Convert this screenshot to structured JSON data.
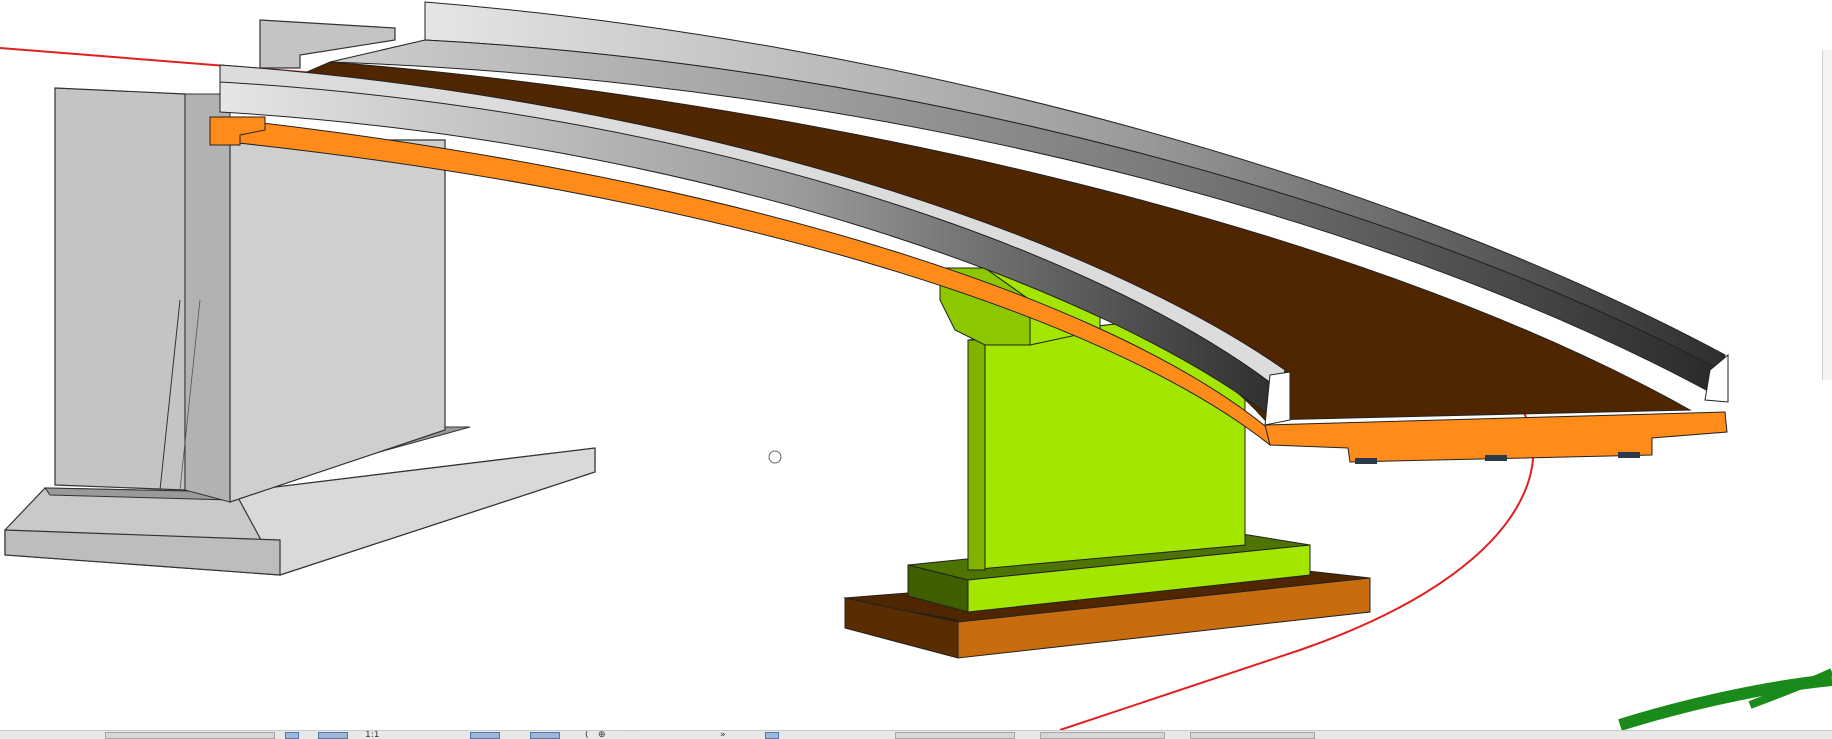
{
  "viewport": {
    "label": "",
    "elements": {
      "abutment_color": "#c9c9c9",
      "abutment_shadow": "#7a7a7a",
      "deck_color": "#4f2600",
      "parapet_light": "#d4d4d4",
      "parapet_dark": "#3a3a3a",
      "bearing_beam_color": "#ff8c1a",
      "pier_color": "#a3e600",
      "pier_shadow": "#4d7300",
      "pile_cap_color": "#c86c10",
      "alignment_color": "#e02020",
      "view_cube_color": "#1a8a1a"
    }
  },
  "statusbar": {
    "icons": [
      "view-scale-icon",
      "detail-level-icon",
      "visual-style-icon",
      "sun-path-icon",
      "shadows-icon",
      "crop-icon",
      "hide-icon",
      "constraints-icon"
    ],
    "glyphs": [
      "1:1",
      "(",
      "⊕",
      "⌒",
      "»"
    ]
  }
}
